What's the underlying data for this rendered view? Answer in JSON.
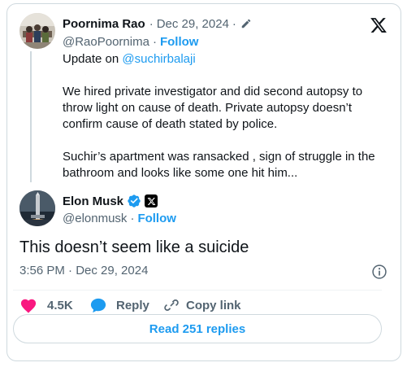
{
  "accent_color": "#1d9bf0",
  "like_color": "#f91880",
  "quoted": {
    "name": "Poornima Rao",
    "date": "Dec 29, 2024",
    "separator": "·",
    "handle": "@RaoPoornima",
    "follow_label": "Follow",
    "intro_prefix": "Update on ",
    "mention": "@suchirbalaji",
    "body_1": " We hired private investigator and did second autopsy to\nthrow light on cause of death. Private autopsy doesn’t\nconfirm cause of death stated by police.",
    "body_2": "Suchir’s apartment was ransacked , sign of struggle in the\nbathroom and looks like some one hit him..."
  },
  "tweet": {
    "name": "Elon Musk",
    "handle": "@elonmusk",
    "separator": "·",
    "follow_label": "Follow",
    "text": "This doesn’t seem like a suicide",
    "timestamp": "3:56 PM · Dec 29, 2024"
  },
  "actions": {
    "likes": "4.5K",
    "reply_label": "Reply",
    "copy_link_label": "Copy link"
  },
  "read_replies_label": "Read 251 replies",
  "icons": {
    "brand": "x-logo-icon",
    "edit": "pencil-icon",
    "verified": "verified-badge-icon",
    "affiliate": "x-affiliate-badge-icon",
    "info": "info-icon",
    "like": "heart-icon",
    "reply": "speech-bubble-icon",
    "copy": "link-icon"
  }
}
